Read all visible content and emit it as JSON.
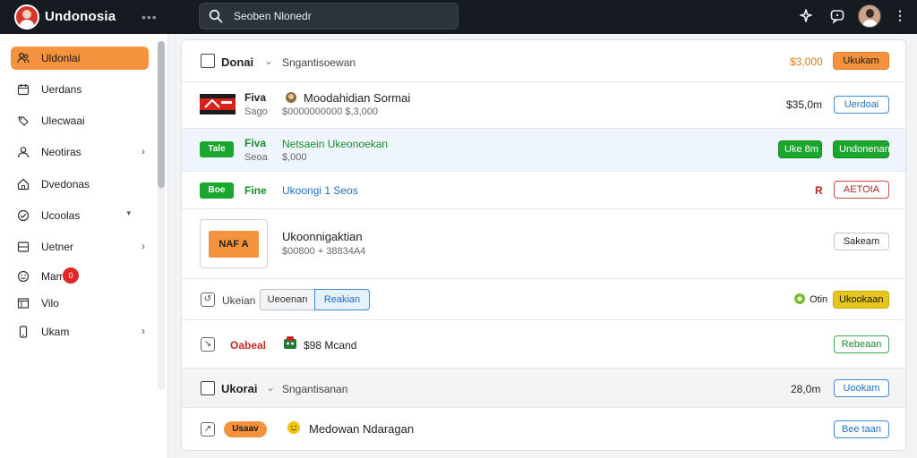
{
  "app": {
    "name": "Undonosia",
    "more": "•••"
  },
  "search": {
    "text": "Seoben Nlonedr"
  },
  "sidebar": {
    "items": [
      {
        "label": "Uldonlai",
        "icon": "people-icon",
        "active": true
      },
      {
        "label": "Uerdans",
        "icon": "calendar-icon"
      },
      {
        "label": "Ulecwaai",
        "icon": "link-icon"
      },
      {
        "label": "Neotiras",
        "icon": "user-icon",
        "chevron": "›"
      },
      {
        "label": "Dvedonas",
        "icon": "home-icon"
      },
      {
        "label": "Ucoolas",
        "icon": "globe-icon",
        "caret": "▾"
      },
      {
        "label": "Uetner",
        "icon": "grid-icon",
        "chevron": "›"
      },
      {
        "label": "Mam",
        "icon": "smile-icon",
        "badge": "0"
      },
      {
        "label": "Vilo",
        "icon": "window-icon"
      },
      {
        "label": "Ukam",
        "icon": "phone-icon",
        "chevron": "›"
      }
    ]
  },
  "rows": [
    {
      "title": "Donai",
      "caret": "⌄",
      "subtitle": "Sngantisoewan",
      "amount": "$3,000",
      "action": "Ukukam"
    },
    {
      "brand": "Fiva",
      "brand_sub": "Sago",
      "product": "Moodahidian Sormai",
      "product_sub": "$0000000000 $,3,000",
      "amount": "$35,0m",
      "action": "Uerdoai"
    },
    {
      "tag": "Tale",
      "brand": "Fiva",
      "brand_sub": "Seoa",
      "product": "Netsaein Ukeonoekan",
      "product_sub": "$,000",
      "status": "Uke 8m",
      "action": "Undonenan"
    },
    {
      "tag": "Boe",
      "brand": "Fine",
      "product": "Ukoongi 1 Seos",
      "amount": "R",
      "action": "AETOIA"
    },
    {
      "thumb": "NAF A",
      "product": "Ukoonnigaktian",
      "product_sub": "$00800 + 38834A4",
      "action": "Sakeam"
    },
    {
      "label": "Ukeian",
      "seg_a": "Ueoenan",
      "seg_b": "Reakian",
      "status": "Otin",
      "action": "Ukookaan"
    },
    {
      "label": "Oabeal",
      "product": "$98 Mcand",
      "action": "Rebeaan"
    },
    {
      "title": "Ukorai",
      "caret": "⌄",
      "subtitle": "Sngantisanan",
      "amount": "28,0m",
      "action": "Uookam"
    },
    {
      "tag": "Usaav",
      "product": "Medowan Ndaragan",
      "action": "Bee taan"
    }
  ],
  "colors": {
    "accent": "#f5923e",
    "topbar": "#161b22",
    "green": "#1aa72e",
    "blue": "#3c8ad8",
    "red": "#d04a4a",
    "yellow": "#e6c61a"
  }
}
